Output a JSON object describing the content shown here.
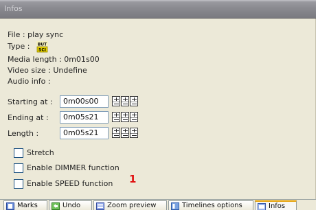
{
  "window": {
    "title": "Infos"
  },
  "info": {
    "file": "File : play sync",
    "type_label": "Type :",
    "type_icon": "but-sci-icon",
    "type_icon_text_top": "BUT",
    "type_icon_text_bottom": "SCI",
    "media_length": "Media length : 0m01s00",
    "video_size": "Video size : Undefine",
    "audio_info": "Audio info :"
  },
  "timing": {
    "starting_label": "Starting at :",
    "starting_value": "0m00s00",
    "ending_label": "Ending at :",
    "ending_value": "0m05s21",
    "length_label": "Length :",
    "length_value": "0m05s21"
  },
  "options": {
    "stretch": "Stretch",
    "dimmer": "Enable DIMMER function",
    "speed": "Enable SPEED function"
  },
  "annotation": "1",
  "tabs": [
    {
      "label": "Marks",
      "icon": "marks-icon"
    },
    {
      "label": "Undo",
      "icon": "undo-icon"
    },
    {
      "label": "Zoom preview",
      "icon": "zoom-preview-icon"
    },
    {
      "label": "Timelines options",
      "icon": "timelines-options-icon"
    },
    {
      "label": "Infos",
      "icon": "infos-icon",
      "active": true
    }
  ],
  "colors": {
    "title_bar": "#8a8a90",
    "panel_bg": "#ece9d8",
    "field_border": "#7f9db9",
    "checkbox_border": "#1c5180",
    "annotation": "#e01010",
    "active_tab_accent": "#e6a000"
  }
}
